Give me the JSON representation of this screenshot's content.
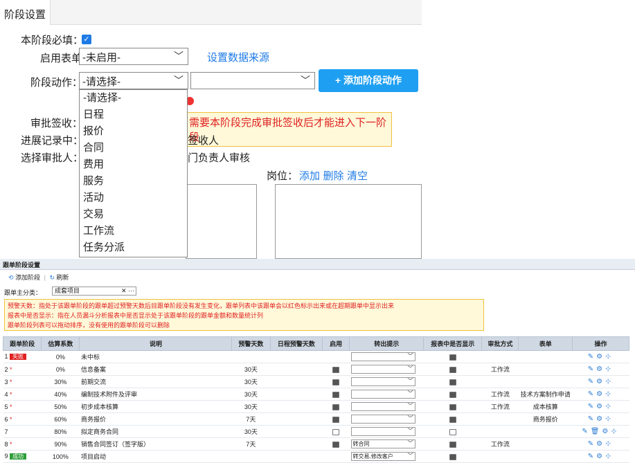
{
  "top": {
    "tab_label": "阶段设置",
    "required_label": "本阶段必填：",
    "form_label": "启用表单：",
    "form_value": "-未启用-",
    "data_source_link": "设置数据来源",
    "action_label": "阶段动作：",
    "action_value": "-请选择-",
    "add_action_button": "+ 添加阶段动作",
    "approval_label": "审批签收：",
    "approval_warning": "需要本阶段完成审批签收后才能进入下一阶段",
    "progress_label": "进展记录中：",
    "progress_value_partial": "签收人",
    "approver_label": "选择审批人：",
    "approver_value_partial": "门负责人审核",
    "position_label": "岗位：",
    "position_links": [
      "添加",
      "删除",
      "清空"
    ],
    "dropdown_options": [
      "-请选择-",
      "日程",
      "报价",
      "合同",
      "费用",
      "服务",
      "活动",
      "交易",
      "工作流",
      "任务分派"
    ]
  },
  "bottom": {
    "title": "跟单阶段设置",
    "toolbar": {
      "add": "添加阶段",
      "refresh": "刷新"
    },
    "category_label": "跟单主分类：",
    "category_value": "成套项目",
    "category_clear": "✕ ···",
    "notes": [
      "预警天数：指处于该跟单阶段的跟单超过预警天数后目跟单阶段没有发生变化，跟单列表中该跟单会以红色标示出来或在超期跟单中显示出来",
      "报表中是否显示：指在人员漏斗分析报表中是否显示处于该跟单阶段的跟单金额和数量统计列",
      "跟单阶段列表可以拖动排序，没有使用的跟单阶段可以删除"
    ],
    "columns": [
      "跟单阶段",
      "估算系数",
      "说明",
      "预警天数",
      "日程预警天数",
      "启用",
      "转出提示",
      "报表中是否显示",
      "审批方式",
      "表单",
      "操作"
    ],
    "rows": [
      {
        "no": "1",
        "badge": "失败",
        "badge_type": "red",
        "star": "",
        "coef": "0%",
        "desc": "未中标",
        "warn": "",
        "enabled": "none",
        "hint": "",
        "report": true,
        "approve": "",
        "form": "",
        "ops": "edit,gear,tree"
      },
      {
        "no": "2",
        "badge": "",
        "badge_type": "",
        "star": "*",
        "coef": "0%",
        "desc": "信息备案",
        "warn": "30天",
        "enabled": "on",
        "hint": "",
        "report": true,
        "approve": "工作流",
        "form": "",
        "ops": "edit,gear,tree"
      },
      {
        "no": "3",
        "badge": "",
        "badge_type": "",
        "star": "*",
        "coef": "30%",
        "desc": "前期交流",
        "warn": "30天",
        "enabled": "on",
        "hint": "",
        "report": true,
        "approve": "",
        "form": "",
        "ops": "edit,gear,tree"
      },
      {
        "no": "4",
        "badge": "",
        "badge_type": "",
        "star": "*",
        "coef": "40%",
        "desc": "编制技术附件及评审",
        "warn": "30天",
        "enabled": "on",
        "hint": "",
        "report": true,
        "approve": "工作流",
        "form": "技术方案制作申请",
        "ops": "edit,gear,tree"
      },
      {
        "no": "5",
        "badge": "",
        "badge_type": "",
        "star": "*",
        "coef": "50%",
        "desc": "初步成本核算",
        "warn": "30天",
        "enabled": "on",
        "hint": "",
        "report": true,
        "approve": "工作流",
        "form": "成本核算",
        "ops": "edit,gear,tree"
      },
      {
        "no": "6",
        "badge": "",
        "badge_type": "",
        "star": "*",
        "coef": "60%",
        "desc": "商务报价",
        "warn": "7天",
        "enabled": "on",
        "hint": "",
        "report": true,
        "approve": "",
        "form": "商务报价",
        "ops": "edit,gear,tree"
      },
      {
        "no": "7",
        "badge": "",
        "badge_type": "",
        "star": "",
        "coef": "80%",
        "desc": "拟定商务合同",
        "warn": "30天",
        "enabled": "off",
        "hint": "",
        "report": false,
        "approve": "",
        "form": "",
        "ops": "edit,trash,gear,tree"
      },
      {
        "no": "8",
        "badge": "",
        "badge_type": "",
        "star": "*",
        "coef": "90%",
        "desc": "销售合同签订（签字版）",
        "warn": "7天",
        "enabled": "on",
        "hint": "转合同",
        "report": true,
        "approve": "工作流",
        "form": "",
        "ops": "edit,gear,tree"
      },
      {
        "no": "9",
        "badge": "成功",
        "badge_type": "green",
        "star": "",
        "coef": "100%",
        "desc": "项目启动",
        "warn": "",
        "enabled": "none",
        "hint": "转交易,修改客户",
        "report": true,
        "approve": "",
        "form": "",
        "ops": "edit,gear,tree"
      }
    ]
  },
  "colors": {
    "accent": "#1e7be6",
    "button": "#1e9ff2",
    "warning_text": "#e02020",
    "warning_bg": "#fff9d9",
    "header_bg": "#cfd8e3"
  }
}
